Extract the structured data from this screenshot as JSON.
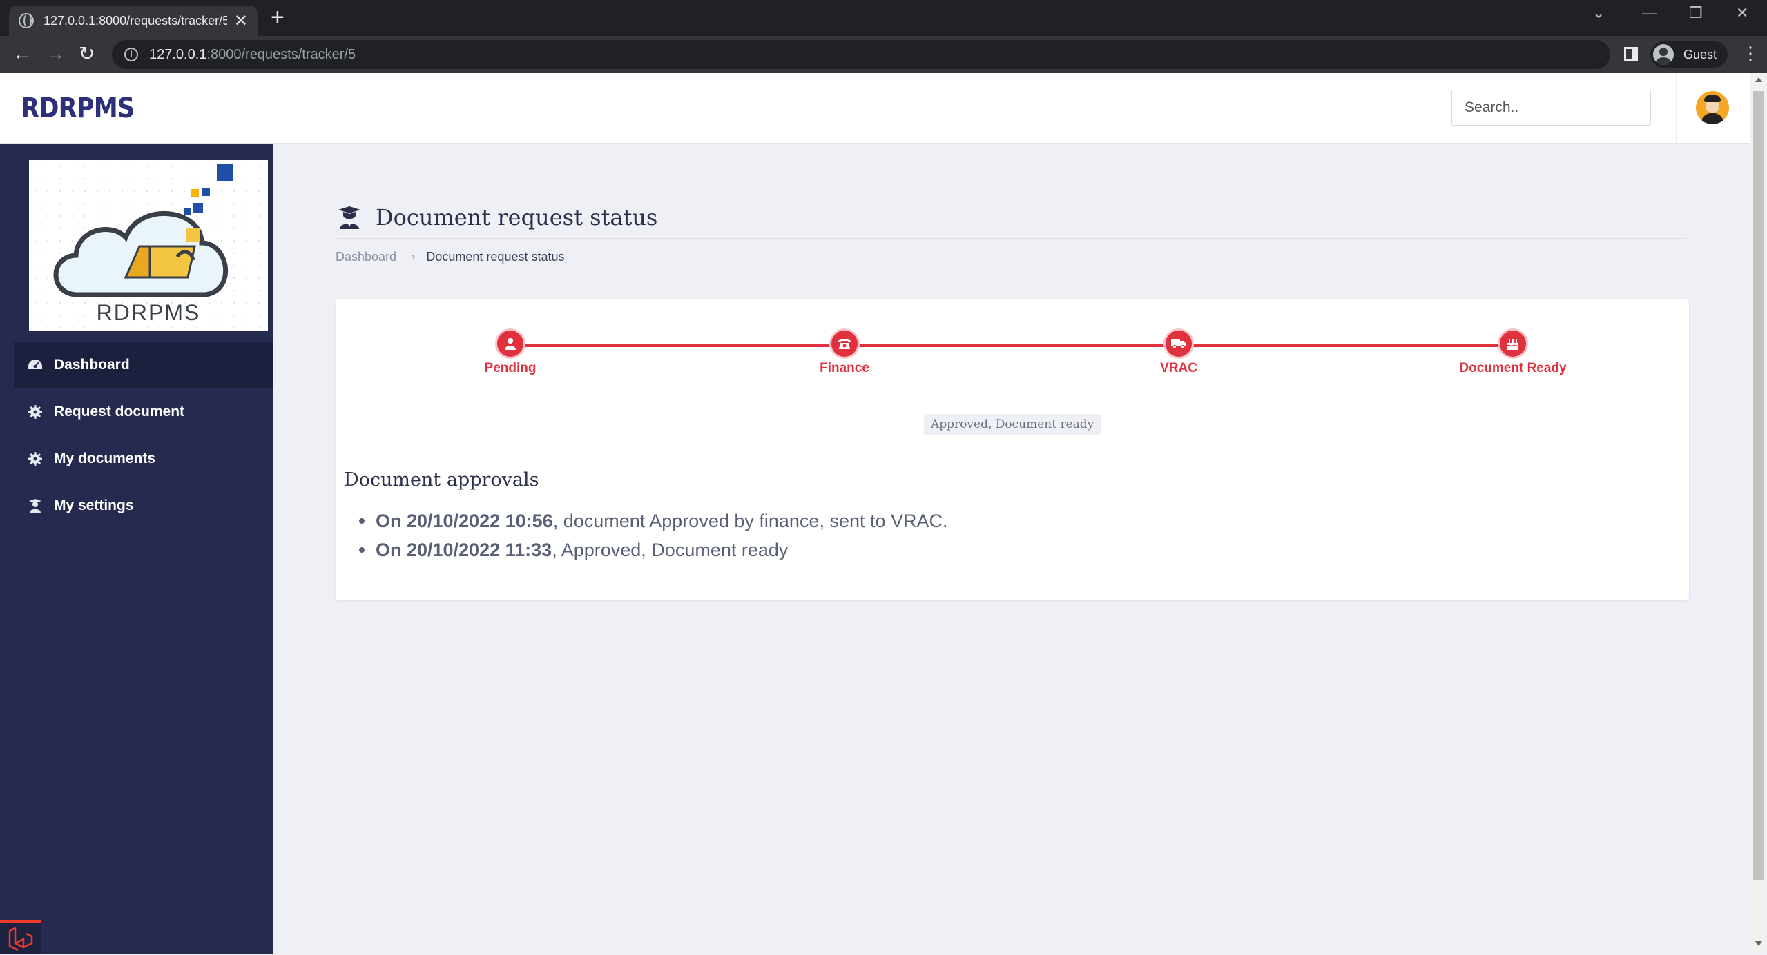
{
  "browser": {
    "tab_title": "127.0.0.1:8000/requests/tracker/5",
    "url_host": "127.0.0.1",
    "url_path": ":8000/requests/tracker/5",
    "profile_name": "Guest"
  },
  "header": {
    "brand": "RDRPMS",
    "search_placeholder": "Search.."
  },
  "sidebar": {
    "logo_text": "RDRPMS",
    "items": [
      {
        "label": "Dashboard",
        "icon": "dashboard-icon",
        "active": true
      },
      {
        "label": "Request document",
        "icon": "gear-icon",
        "active": false
      },
      {
        "label": "My documents",
        "icon": "gear-icon",
        "active": false
      },
      {
        "label": "My settings",
        "icon": "user-graduate-icon",
        "active": false
      }
    ]
  },
  "main": {
    "title": "Document request status",
    "breadcrumb": {
      "root": "Dashboard",
      "current": "Document request status"
    },
    "steps": [
      {
        "label": "Pending",
        "icon": "user-icon"
      },
      {
        "label": "Finance",
        "icon": "phone-icon"
      },
      {
        "label": "VRAC",
        "icon": "truck-icon"
      },
      {
        "label": "Document Ready",
        "icon": "cake-icon"
      }
    ],
    "status": "Approved, Document ready",
    "approvals_title": "Document approvals",
    "approvals": [
      {
        "date": "On 20/10/2022 10:56",
        "text": ", document Approved by finance, sent to VRAC."
      },
      {
        "date": "On 20/10/2022 11:33",
        "text": ", Approved, Document ready"
      }
    ]
  },
  "colors": {
    "accent": "#e0313f",
    "sidebar": "#262a4f",
    "brand": "#2d2f7a"
  }
}
